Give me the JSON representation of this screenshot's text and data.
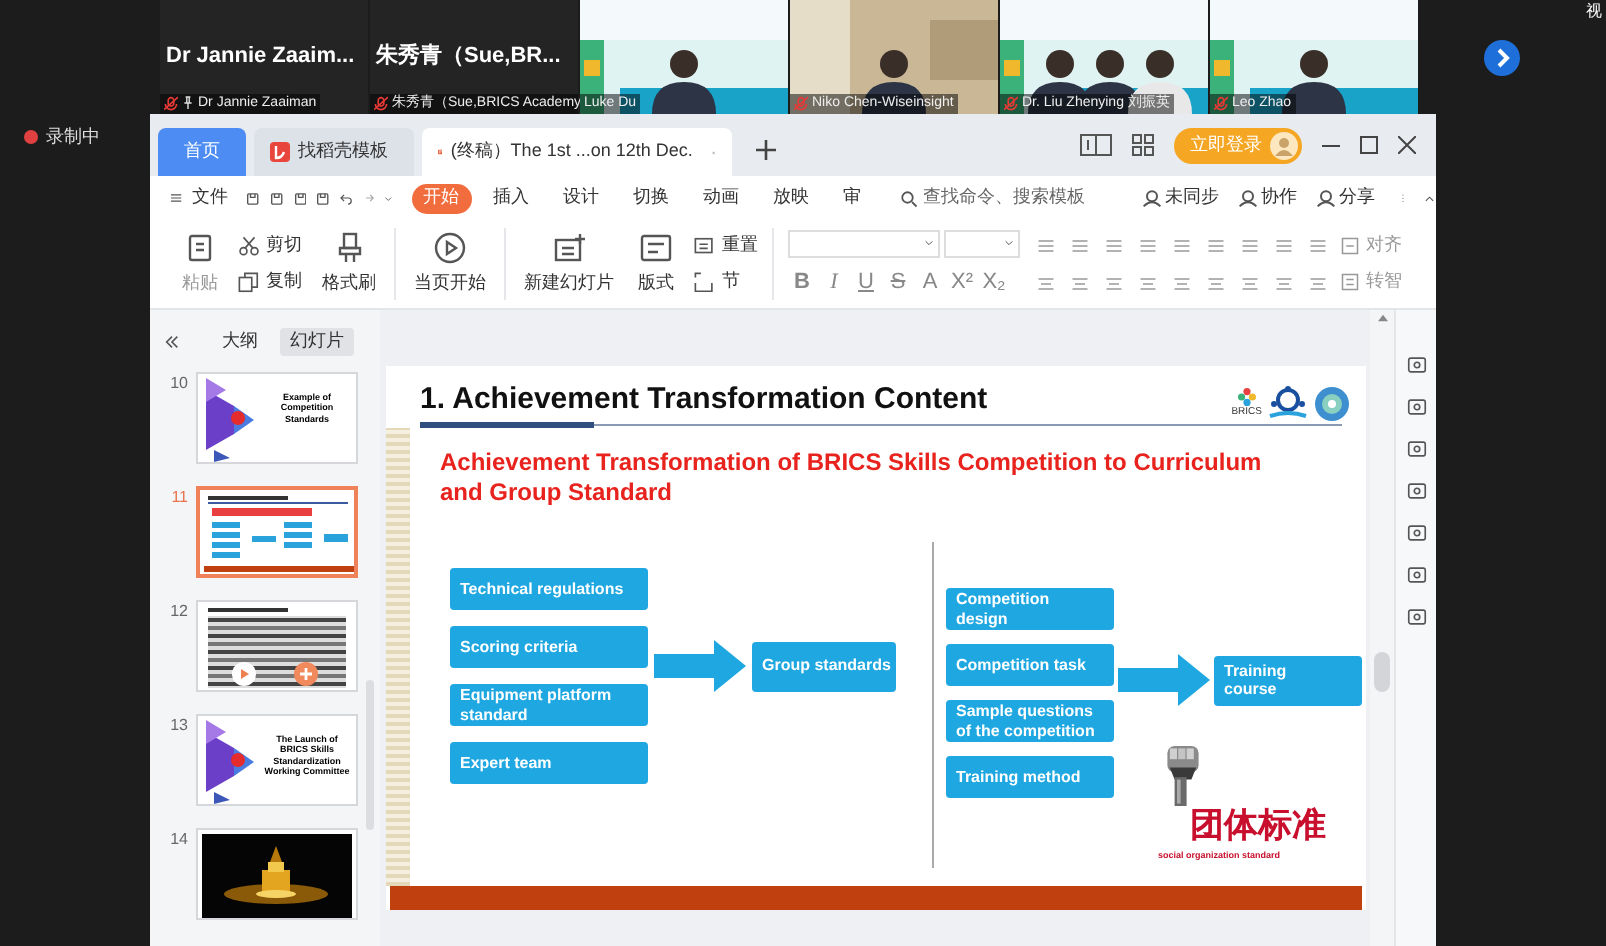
{
  "participants": [
    {
      "kind": "name",
      "name": "Dr Jannie Zaaim...",
      "label": "Dr Jannie Zaaiman",
      "muted": true,
      "pinned": true
    },
    {
      "kind": "name",
      "name": "朱秀青（Sue,BR...",
      "label": "朱秀青（Sue,BRICS Academy",
      "muted": true,
      "pinned": false
    },
    {
      "kind": "video",
      "label": "Luke Du",
      "muted": false,
      "pinned": false
    },
    {
      "kind": "video",
      "label": "Niko Chen-Wiseinsight",
      "muted": true,
      "pinned": false
    },
    {
      "kind": "video",
      "label": "Dr. Liu Zhenying 刘振英",
      "muted": true,
      "pinned": false
    },
    {
      "kind": "video",
      "label": "Leo Zhao",
      "muted": true,
      "pinned": false
    }
  ],
  "corner_text": "视",
  "recording": {
    "label": "录制中"
  },
  "wps": {
    "tabs": [
      {
        "kind": "home",
        "label": "首页",
        "selected": false
      },
      {
        "kind": "template",
        "label": "找稻壳模板",
        "selected": false
      },
      {
        "kind": "document",
        "label": "(终稿）The 1st ...on 12th Dec.",
        "selected": true
      }
    ],
    "login": "立即登录",
    "file_menu": "文件",
    "ribbon_tabs": [
      {
        "label": "开始",
        "selected": true
      },
      {
        "label": "插入",
        "selected": false
      },
      {
        "label": "设计",
        "selected": false
      },
      {
        "label": "切换",
        "selected": false
      },
      {
        "label": "动画",
        "selected": false
      },
      {
        "label": "放映",
        "selected": false
      },
      {
        "label": "审",
        "selected": false
      }
    ],
    "search": {
      "placeholder": "查找命令、搜索模板"
    },
    "actions": [
      "未同步",
      "协作",
      "分享"
    ],
    "ribbon": {
      "paste": "粘贴",
      "cut": "剪切",
      "copy": "复制",
      "format_painter": "格式刷",
      "play_from_current": "当页开始",
      "new_slide": "新建幻灯片",
      "layout": "版式",
      "reset": "重置",
      "section": "节",
      "align": "对齐",
      "convert": "转智"
    },
    "format_buttons": [
      "B",
      "I",
      "U",
      "S",
      "A",
      "X²",
      "X₂"
    ],
    "panel": {
      "tabs": [
        {
          "label": "大纲",
          "selected": false
        },
        {
          "label": "幻灯片",
          "selected": true
        }
      ],
      "slides": [
        {
          "number": "10",
          "kind": "section",
          "title": "Example of Competition Standards",
          "selected": false
        },
        {
          "number": "11",
          "kind": "diagram",
          "selected": true
        },
        {
          "number": "12",
          "kind": "table",
          "selected": false
        },
        {
          "number": "13",
          "kind": "section",
          "title": "The Launch of BRICS Skills Standardization Working Committee",
          "selected": false
        },
        {
          "number": "14",
          "selected": false
        }
      ]
    },
    "slide": {
      "title": "1. Achievement Transformation Content",
      "logo_text": "BRICS",
      "heading": "Achievement Transformation of BRICS Skills Competition to Curriculum and Group Standard",
      "left_items": [
        "Technical regulations",
        "Scoring criteria",
        "Equipment platform standard",
        "Expert team"
      ],
      "left_result": "Group standards",
      "right_items": [
        "Competition design",
        "Competition task",
        "Sample questions of the competition",
        "Training method"
      ],
      "right_result": "Training course",
      "stamp": {
        "title": "团体标准",
        "subtitle": "social organization standard"
      }
    }
  }
}
